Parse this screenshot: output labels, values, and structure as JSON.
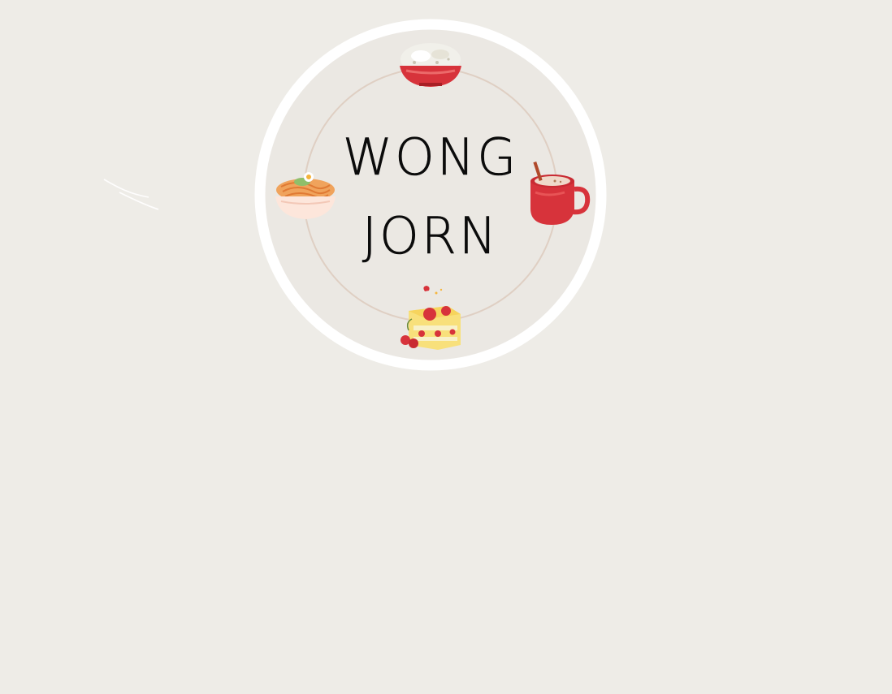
{
  "brand": {
    "line_1": "WONG",
    "line_2": "JORN"
  },
  "icons": [
    "rice-bowl-icon",
    "noodle-bowl-icon",
    "mug-icon",
    "cherry-cake-icon"
  ],
  "colors": {
    "background": "#eeece7",
    "badge_fill": "#ebe8e3",
    "ring_outer": "#ffffff",
    "ring_inner": "#dfcfc3",
    "accent_red": "#d7333b",
    "cake_yellow": "#f6d45d",
    "text": "#0b0b0b"
  }
}
